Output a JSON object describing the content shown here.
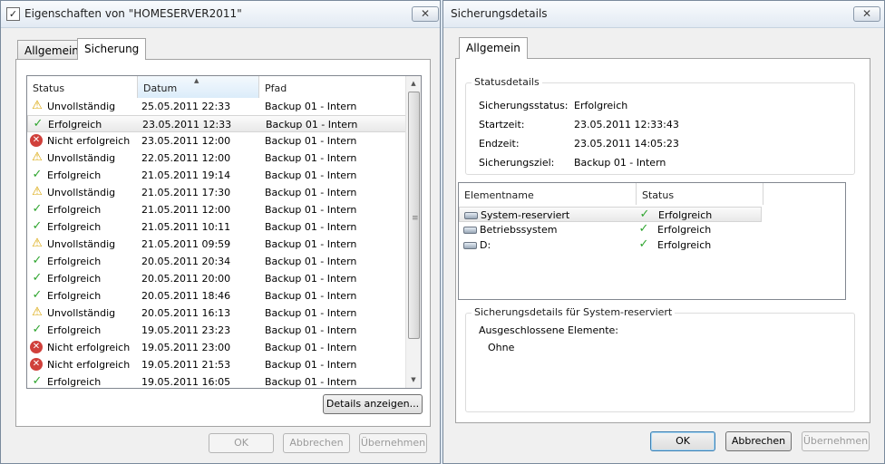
{
  "left_window": {
    "title": "Eigenschaften von \"HOMESERVER2011\"",
    "title_icon": "✓",
    "close_glyph": "✕",
    "tabs": [
      "Allgemein",
      "Sicherung"
    ],
    "active_tab": "Sicherung",
    "list": {
      "columns": [
        "Status",
        "Datum",
        "Pfad"
      ],
      "sorted_column": "Datum",
      "sort_glyph": "▲",
      "rows": [
        {
          "icon": "warning-icon",
          "glyph": "⚠",
          "status": "Unvollständig",
          "date": "25.05.2011 22:33",
          "path": "Backup 01 - Intern"
        },
        {
          "icon": "check-icon",
          "glyph": "✓",
          "status": "Erfolgreich",
          "date": "23.05.2011 12:33",
          "path": "Backup 01 - Intern",
          "selected": true
        },
        {
          "icon": "error-icon",
          "glyph": "✕",
          "status": "Nicht erfolgreich",
          "date": "23.05.2011 12:00",
          "path": "Backup 01 - Intern"
        },
        {
          "icon": "warning-icon",
          "glyph": "⚠",
          "status": "Unvollständig",
          "date": "22.05.2011 12:00",
          "path": "Backup 01 - Intern"
        },
        {
          "icon": "check-icon",
          "glyph": "✓",
          "status": "Erfolgreich",
          "date": "21.05.2011 19:14",
          "path": "Backup 01 - Intern"
        },
        {
          "icon": "warning-icon",
          "glyph": "⚠",
          "status": "Unvollständig",
          "date": "21.05.2011 17:30",
          "path": "Backup 01 - Intern"
        },
        {
          "icon": "check-icon",
          "glyph": "✓",
          "status": "Erfolgreich",
          "date": "21.05.2011 12:00",
          "path": "Backup 01 - Intern"
        },
        {
          "icon": "check-icon",
          "glyph": "✓",
          "status": "Erfolgreich",
          "date": "21.05.2011 10:11",
          "path": "Backup 01 - Intern"
        },
        {
          "icon": "warning-icon",
          "glyph": "⚠",
          "status": "Unvollständig",
          "date": "21.05.2011 09:59",
          "path": "Backup 01 - Intern"
        },
        {
          "icon": "check-icon",
          "glyph": "✓",
          "status": "Erfolgreich",
          "date": "20.05.2011 20:34",
          "path": "Backup 01 - Intern"
        },
        {
          "icon": "check-icon",
          "glyph": "✓",
          "status": "Erfolgreich",
          "date": "20.05.2011 20:00",
          "path": "Backup 01 - Intern"
        },
        {
          "icon": "check-icon",
          "glyph": "✓",
          "status": "Erfolgreich",
          "date": "20.05.2011 18:46",
          "path": "Backup 01 - Intern"
        },
        {
          "icon": "warning-icon",
          "glyph": "⚠",
          "status": "Unvollständig",
          "date": "20.05.2011 16:13",
          "path": "Backup 01 - Intern"
        },
        {
          "icon": "check-icon",
          "glyph": "✓",
          "status": "Erfolgreich",
          "date": "19.05.2011 23:23",
          "path": "Backup 01 - Intern"
        },
        {
          "icon": "error-icon",
          "glyph": "✕",
          "status": "Nicht erfolgreich",
          "date": "19.05.2011 23:00",
          "path": "Backup 01 - Intern"
        },
        {
          "icon": "error-icon",
          "glyph": "✕",
          "status": "Nicht erfolgreich",
          "date": "19.05.2011 21:53",
          "path": "Backup 01 - Intern"
        },
        {
          "icon": "check-icon",
          "glyph": "✓",
          "status": "Erfolgreich",
          "date": "19.05.2011 16:05",
          "path": "Backup 01 - Intern"
        }
      ]
    },
    "scroll": {
      "up_glyph": "▲",
      "down_glyph": "▼",
      "grip_glyph": "≡"
    },
    "details_button": "Details anzeigen...",
    "buttons": {
      "ok": "OK",
      "cancel": "Abbrechen",
      "apply": "Übernehmen"
    }
  },
  "right_window": {
    "title": "Sicherungsdetails",
    "close_glyph": "✕",
    "tab": "Allgemein",
    "status_group": {
      "label": "Statusdetails",
      "fields": [
        {
          "label": "Sicherungsstatus:",
          "value": "Erfolgreich"
        },
        {
          "label": "Startzeit:",
          "value": "23.05.2011 12:33:43"
        },
        {
          "label": "Endzeit:",
          "value": "23.05.2011 14:05:23"
        },
        {
          "label": "Sicherungsziel:",
          "value": "Backup 01 - Intern"
        }
      ]
    },
    "elements": {
      "columns": [
        "Elementname",
        "Status"
      ],
      "rows": [
        {
          "name": "System-reserviert",
          "status": "Erfolgreich",
          "selected": true
        },
        {
          "name": "Betriebssystem",
          "status": "Erfolgreich"
        },
        {
          "name": "D:",
          "status": "Erfolgreich"
        }
      ],
      "status_glyph": "✓"
    },
    "detail_group": {
      "label": "Sicherungsdetails für System-reserviert",
      "excluded_label": "Ausgeschlossene Elemente:",
      "excluded_value": "Ohne"
    },
    "buttons": {
      "ok": "OK",
      "cancel": "Abbrechen",
      "apply": "Übernehmen"
    }
  }
}
